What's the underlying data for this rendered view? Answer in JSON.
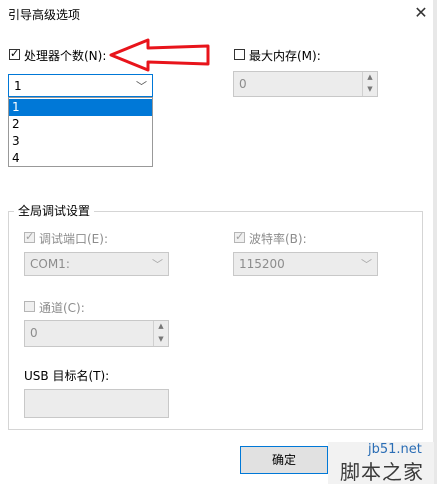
{
  "window": {
    "title": "引导高级选项"
  },
  "processors": {
    "label": "处理器个数(N):",
    "checked": true,
    "selected": "1",
    "options": [
      "1",
      "2",
      "3",
      "4"
    ]
  },
  "max_memory": {
    "label": "最大内存(M):",
    "checked": false,
    "value": "0"
  },
  "global_debug": {
    "title": "全局调试设置",
    "debug_port": {
      "label": "调试端口(E):",
      "checked": true,
      "value": "COM1:"
    },
    "baud_rate": {
      "label": "波特率(B):",
      "checked": true,
      "value": "115200"
    },
    "channel": {
      "label": "通道(C):",
      "checked": false,
      "value": "0"
    },
    "usb_target": {
      "label": "USB 目标名(T):",
      "value": ""
    }
  },
  "buttons": {
    "ok": "确定"
  },
  "watermark": {
    "site": "jb51.net",
    "name": "脚本之家"
  },
  "colors": {
    "accent": "#0078d7",
    "arrow": "#e8141b"
  },
  "icons": {
    "close": "close-icon",
    "chevron": "chevron-down-icon",
    "check": "check-icon"
  }
}
